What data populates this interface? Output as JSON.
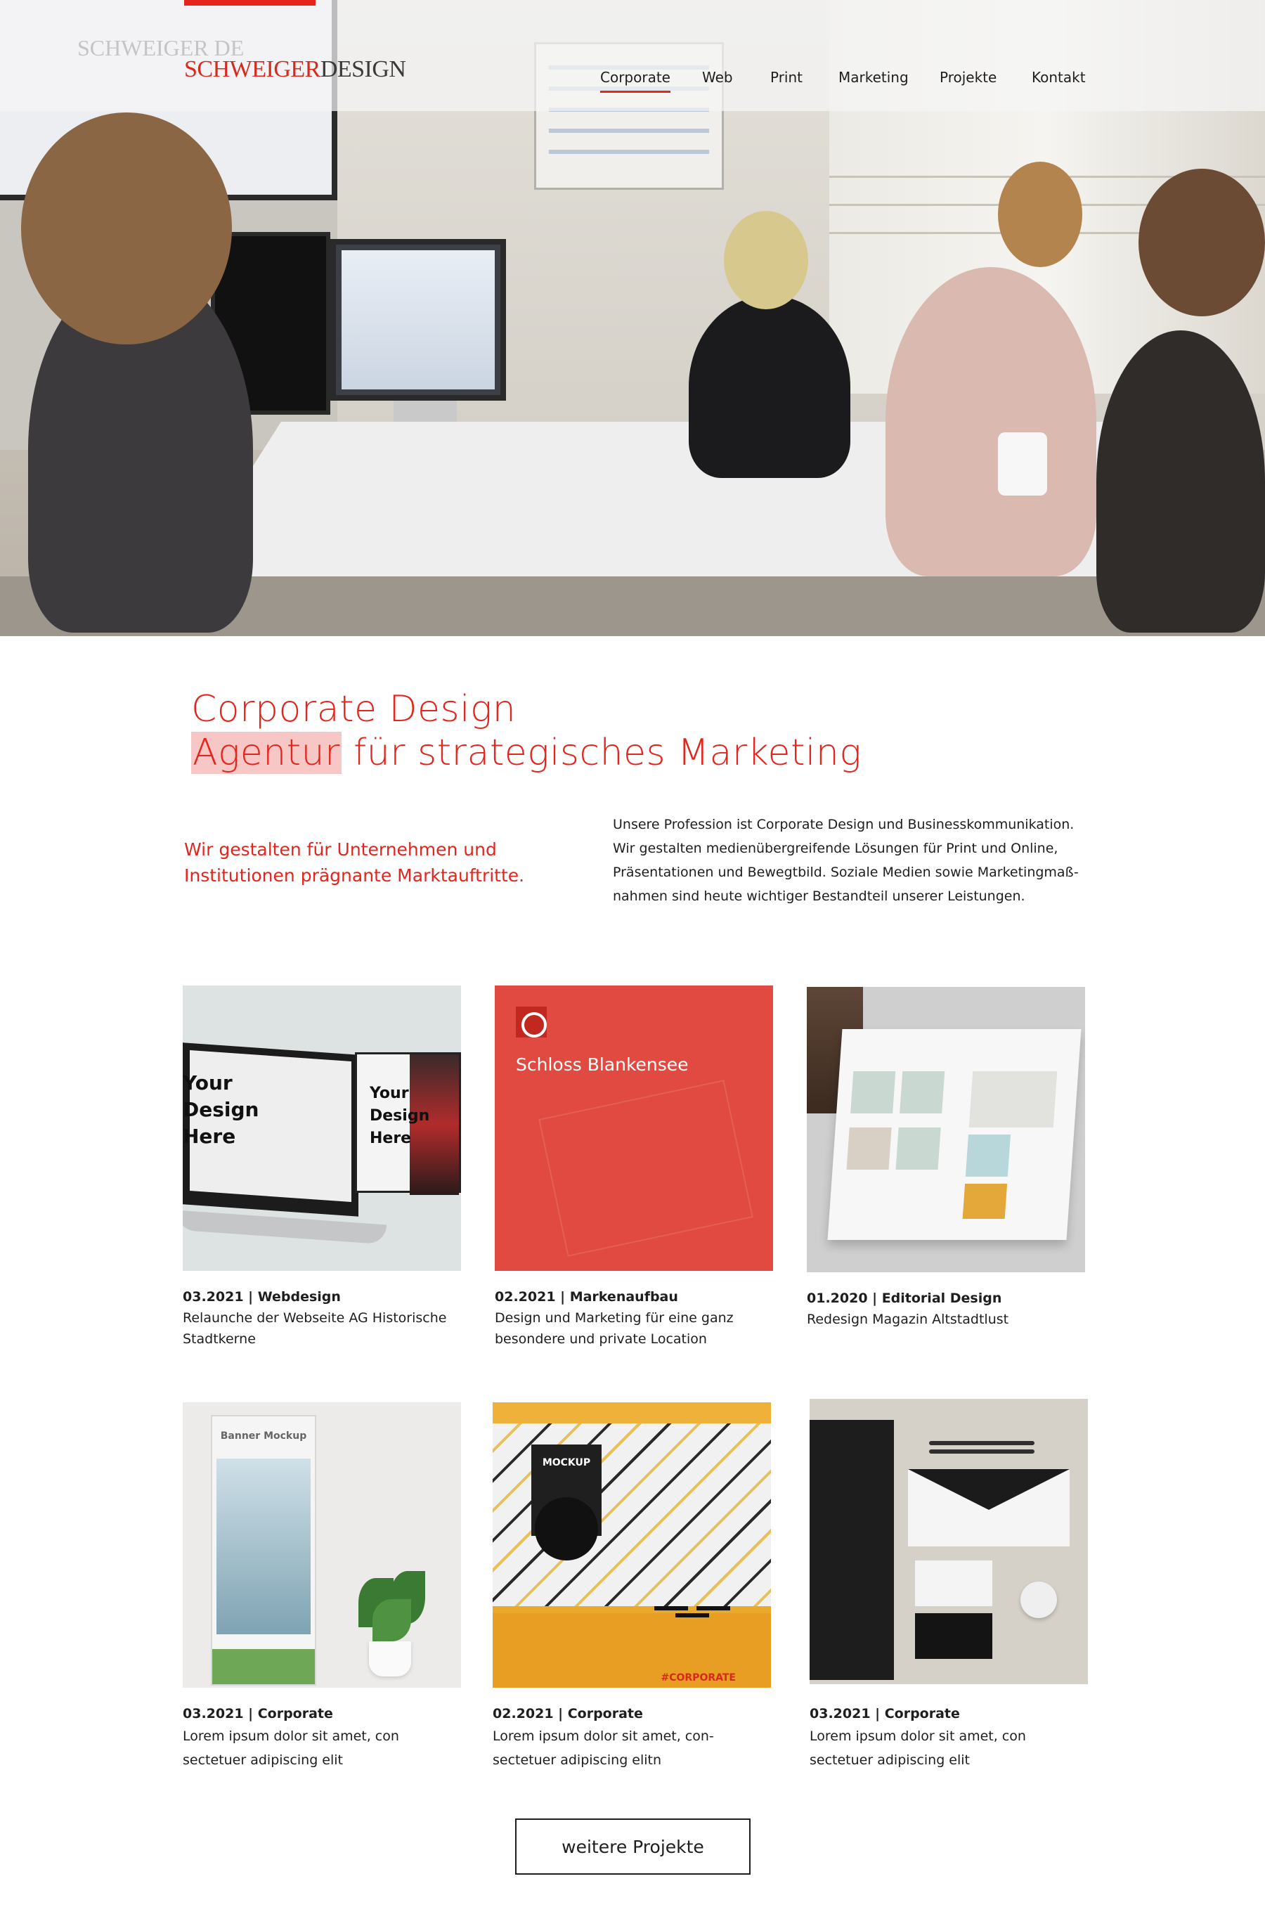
{
  "header": {
    "logo_part1": "SCHWEIGER",
    "logo_part2": "DESIGN",
    "logo_ghost": "SCHWEIGER DE",
    "brand_color": "#e3251e"
  },
  "nav": {
    "items": [
      {
        "label": "Corporate",
        "active": true
      },
      {
        "label": "Web",
        "active": false
      },
      {
        "label": "Print",
        "active": false
      },
      {
        "label": "Marketing",
        "active": false
      },
      {
        "label": "Projekte",
        "active": false
      },
      {
        "label": "Kontakt",
        "active": false
      }
    ]
  },
  "intro": {
    "title_line1": "Corporate Design",
    "title_highlight": "Agentur",
    "title_line2_rest": " für strategisches Marketing",
    "lead": "Wir gestalten für Unternehmen und Institutionen prägnante Marktauftritte.",
    "body_lines": [
      "Unsere Profession ist Corporate Design und Businesskommunikation.",
      "Wir gestalten medienübergreifende Lösungen für Print und Online,",
      "Präsentationen und Bewegtbild. Soziale Medien sowie Marketingmaß-",
      "nahmen sind heute wichtiger Bestandteil unserer Leistungen."
    ]
  },
  "projects": [
    {
      "meta": "03.2021 | Webdesign",
      "desc_lines": [
        "Relaunche der Webseite AG Historische",
        "Stadtkerne"
      ],
      "img_text": [
        "Your",
        "Design",
        "Here"
      ],
      "img_text_small": [
        "Your",
        "Design",
        "Here"
      ]
    },
    {
      "meta": "02.2021 | Markenaufbau",
      "desc_lines": [
        "Design und Marketing für eine ganz",
        "besondere und private Location"
      ],
      "img_title": "Schloss Blankensee"
    },
    {
      "meta": "01.2020 | Editorial Design",
      "desc_lines": [
        "Redesign Magazin Altstadtlust"
      ]
    },
    {
      "meta": "03.2021 | Corporate",
      "desc_lines": [
        "Lorem ipsum dolor sit amet, con",
        "sectetuer adipiscing elit"
      ],
      "img_label": "Banner Mockup"
    },
    {
      "meta": "02.2021 | Corporate",
      "desc_lines": [
        "Lorem ipsum dolor sit amet, con-",
        "sectetuer adipiscing elitn"
      ],
      "img_label": "MOCKUP",
      "img_tag": "#CORPORATE"
    },
    {
      "meta": "03.2021 | Corporate",
      "desc_lines": [
        "Lorem ipsum dolor sit amet, con",
        "sectetuer adipiscing elit"
      ]
    }
  ],
  "more_button": "weitere Projekte"
}
